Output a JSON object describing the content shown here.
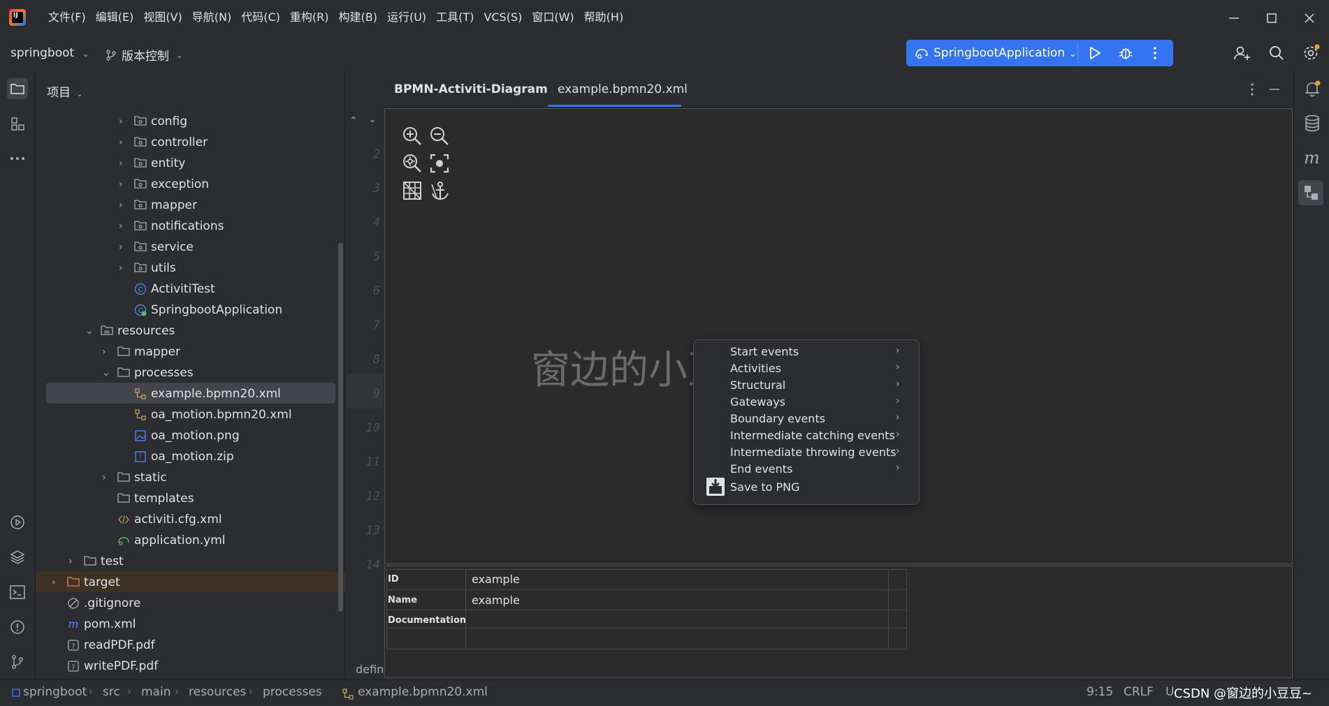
{
  "window": {
    "menu": [
      "文件(F)",
      "编辑(E)",
      "视图(V)",
      "导航(N)",
      "代码(C)",
      "重构(R)",
      "构建(B)",
      "运行(U)",
      "工具(T)",
      "VCS(S)",
      "窗口(W)",
      "帮助(H)"
    ],
    "logo_text": "IJ"
  },
  "toolbar": {
    "project": "springboot",
    "vcs": "版本控制",
    "run_config": "SpringbootApplication",
    "accent": "#3574f0"
  },
  "project_panel": {
    "title": "项目",
    "items": [
      {
        "label": "config",
        "icon": "package-folder-icon"
      },
      {
        "label": "controller",
        "icon": "package-folder-icon"
      },
      {
        "label": "entity",
        "icon": "package-folder-icon"
      },
      {
        "label": "exception",
        "icon": "package-folder-icon"
      },
      {
        "label": "mapper",
        "icon": "package-folder-icon"
      },
      {
        "label": "notifications",
        "icon": "package-folder-icon"
      },
      {
        "label": "service",
        "icon": "package-folder-icon"
      },
      {
        "label": "utils",
        "icon": "package-folder-icon"
      },
      {
        "label": "ActivitiTest",
        "icon": "class-icon"
      },
      {
        "label": "SpringbootApplication",
        "icon": "spring-class-icon"
      },
      {
        "label": "resources",
        "icon": "resources-folder-icon"
      },
      {
        "label": "mapper",
        "icon": "folder-icon"
      },
      {
        "label": "processes",
        "icon": "folder-icon"
      },
      {
        "label": "example.bpmn20.xml",
        "icon": "bpmn-file-icon"
      },
      {
        "label": "oa_motion.bpmn20.xml",
        "icon": "bpmn-file-icon"
      },
      {
        "label": "oa_motion.png",
        "icon": "image-file-icon"
      },
      {
        "label": "oa_motion.zip",
        "icon": "zip-file-icon"
      },
      {
        "label": "static",
        "icon": "folder-icon"
      },
      {
        "label": "templates",
        "icon": "folder-icon"
      },
      {
        "label": "activiti.cfg.xml",
        "icon": "xml-file-icon"
      },
      {
        "label": "application.yml",
        "icon": "yaml-file-icon"
      },
      {
        "label": "test",
        "icon": "folder-icon"
      },
      {
        "label": "target",
        "icon": "excluded-folder-icon"
      },
      {
        "label": ".gitignore",
        "icon": "gitignore-icon"
      },
      {
        "label": "pom.xml",
        "icon": "maven-icon"
      },
      {
        "label": "readPDF.pdf",
        "icon": "unknown-file-icon"
      },
      {
        "label": "writePDF.pdf",
        "icon": "unknown-file-icon"
      }
    ]
  },
  "gutter": {
    "lines": [
      "2",
      "3",
      "4",
      "5",
      "6",
      "7",
      "8",
      "9",
      "10",
      "11",
      "12",
      "13",
      "14"
    ],
    "footer_text": "defin"
  },
  "editor": {
    "tabs": [
      "BPMN-Activiti-Diagram",
      "example.bpmn20.xml"
    ],
    "watermark": "窗边的小豆豆~"
  },
  "context_menu": {
    "items": [
      {
        "label": "Start events",
        "submenu": true
      },
      {
        "label": "Activities",
        "submenu": true
      },
      {
        "label": "Structural",
        "submenu": true
      },
      {
        "label": "Gateways",
        "submenu": true
      },
      {
        "label": "Boundary events",
        "submenu": true
      },
      {
        "label": "Intermediate catching events",
        "submenu": true
      },
      {
        "label": "Intermediate throwing events",
        "submenu": true
      },
      {
        "label": "End events",
        "submenu": true
      }
    ],
    "save_label": "Save to PNG"
  },
  "properties": {
    "rows": [
      {
        "key": "ID",
        "value": "example"
      },
      {
        "key": "Name",
        "value": "example"
      },
      {
        "key": "Documentation",
        "value": ""
      },
      {
        "key": "",
        "value": ""
      }
    ]
  },
  "statusbar": {
    "breadcrumb": [
      "springboot",
      "src",
      "main",
      "resources",
      "processes",
      "example.bpmn20.xml"
    ],
    "position": "9:15",
    "line_ending": "CRLF",
    "encoding": "U",
    "watermark": "CSDN @窗边的小豆豆~"
  }
}
